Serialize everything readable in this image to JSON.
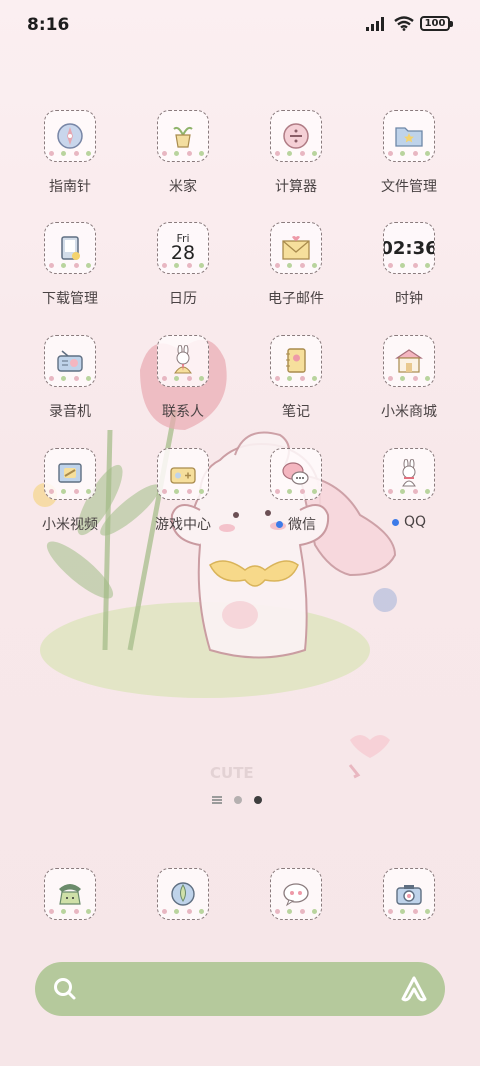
{
  "status_bar": {
    "time": "8:16",
    "battery": "100"
  },
  "apps": [
    {
      "name": "compass",
      "label": "指南针"
    },
    {
      "name": "mijia",
      "label": "米家"
    },
    {
      "name": "calculator",
      "label": "计算器"
    },
    {
      "name": "file-manager",
      "label": "文件管理"
    },
    {
      "name": "downloads",
      "label": "下载管理"
    },
    {
      "name": "calendar",
      "label": "日历",
      "day": "Fri",
      "date": "28"
    },
    {
      "name": "email",
      "label": "电子邮件"
    },
    {
      "name": "clock",
      "label": "时钟",
      "time": "02:36"
    },
    {
      "name": "recorder",
      "label": "录音机"
    },
    {
      "name": "contacts",
      "label": "联系人"
    },
    {
      "name": "notes",
      "label": "笔记"
    },
    {
      "name": "mi-store",
      "label": "小米商城"
    },
    {
      "name": "mi-video",
      "label": "小米视频"
    },
    {
      "name": "game-center",
      "label": "游戏中心"
    },
    {
      "name": "wechat",
      "label": "微信"
    },
    {
      "name": "qq",
      "label": "QQ"
    }
  ],
  "dock": [
    "phone",
    "browser",
    "messages",
    "camera"
  ],
  "wallpaper_text": "CUTE",
  "page_indicator": {
    "pages": 2,
    "active": 2
  },
  "colors": {
    "search_bar": "#b5c99c",
    "notification_dot": "#3d7be8"
  }
}
